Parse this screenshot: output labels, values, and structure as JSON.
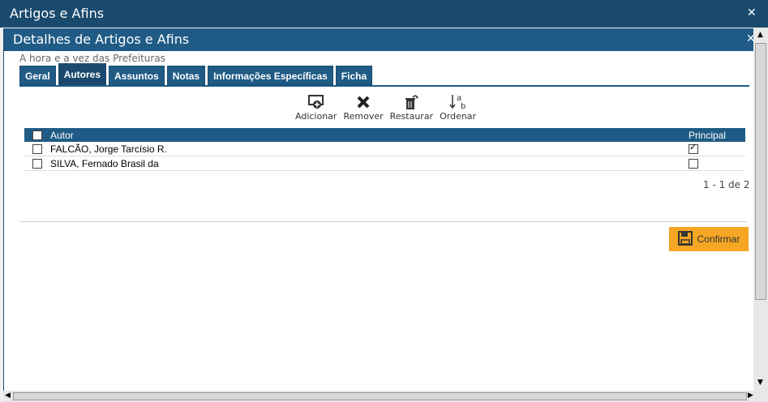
{
  "outer_window": {
    "title": "Artigos e Afins"
  },
  "inner_window": {
    "title": "Detalhes de Artigos e Afins",
    "subtitle": "A hora e a vez das Prefeituras"
  },
  "tabs": [
    {
      "label": "Geral",
      "active": false
    },
    {
      "label": "Autores",
      "active": true
    },
    {
      "label": "Assuntos",
      "active": false
    },
    {
      "label": "Notas",
      "active": false
    },
    {
      "label": "Informações Específicas",
      "active": false
    },
    {
      "label": "Ficha",
      "active": false
    }
  ],
  "toolbar": {
    "add_label": "Adicionar",
    "remove_label": "Remover",
    "restore_label": "Restaurar",
    "sort_label": "Ordenar"
  },
  "grid": {
    "columns": {
      "author": "Autor",
      "principal": "Principal"
    },
    "rows": [
      {
        "author": "FALCÃO, Jorge Tarcísio R.",
        "principal": true
      },
      {
        "author": "SILVA, Fernado Brasil da",
        "principal": false
      }
    ],
    "pager": "1 - 1 de 2"
  },
  "confirm_label": "Confirmar",
  "colors": {
    "header": "#1f5b85",
    "titlebar": "#1a4a6e",
    "accent": "#f5a623"
  }
}
